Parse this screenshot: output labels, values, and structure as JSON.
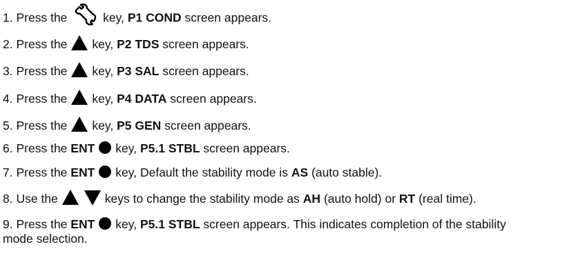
{
  "steps": [
    {
      "num": "1.",
      "pre": "Press the",
      "icon": "wrench-icon",
      "mid": "key,",
      "bold": "P1 COND",
      "post": "screen appears."
    },
    {
      "num": "2.",
      "pre": "Press the",
      "icon": "up-triangle-icon",
      "mid": "key,",
      "bold": "P2 TDS",
      "post": "screen appears."
    },
    {
      "num": "3.",
      "pre": "Press the",
      "icon": "up-triangle-icon",
      "mid": "key,",
      "bold": "P3 SAL",
      "post": "screen appears."
    },
    {
      "num": "4.",
      "pre": "Press the",
      "icon": "up-triangle-icon",
      "mid": "key,",
      "bold": "P4 DATA",
      "post": "screen appears."
    },
    {
      "num": "5.",
      "pre": "Press the",
      "icon": "up-triangle-icon",
      "mid": "key,",
      "bold": "P5 GEN",
      "post": "screen appears."
    },
    {
      "num": "6.",
      "pre": "Press the",
      "key": "ENT",
      "icon": "enter-dot-icon",
      "mid": "key,",
      "bold": "P5.1 STBL",
      "post": "screen appears."
    },
    {
      "num": "7.",
      "pre": "Press the",
      "key": "ENT",
      "icon": "enter-dot-icon",
      "mid": "key, Default the stability mode is",
      "bold": "AS",
      "post": "(auto stable)."
    },
    {
      "num": "8.",
      "pre": "Use the",
      "icons": [
        "up-triangle-icon",
        "down-triangle-icon"
      ],
      "mid": "keys to change the stability mode as",
      "bold": "AH",
      "post": "(auto hold) or",
      "bold2": "RT",
      "post2": "(real time)."
    },
    {
      "num": "9.",
      "pre": "Press the",
      "key": "ENT",
      "icon": "enter-dot-icon",
      "mid": "key,",
      "bold": "P5.1 STBL",
      "post": "screen appears. This indicates completion of the stability mode selection."
    }
  ]
}
